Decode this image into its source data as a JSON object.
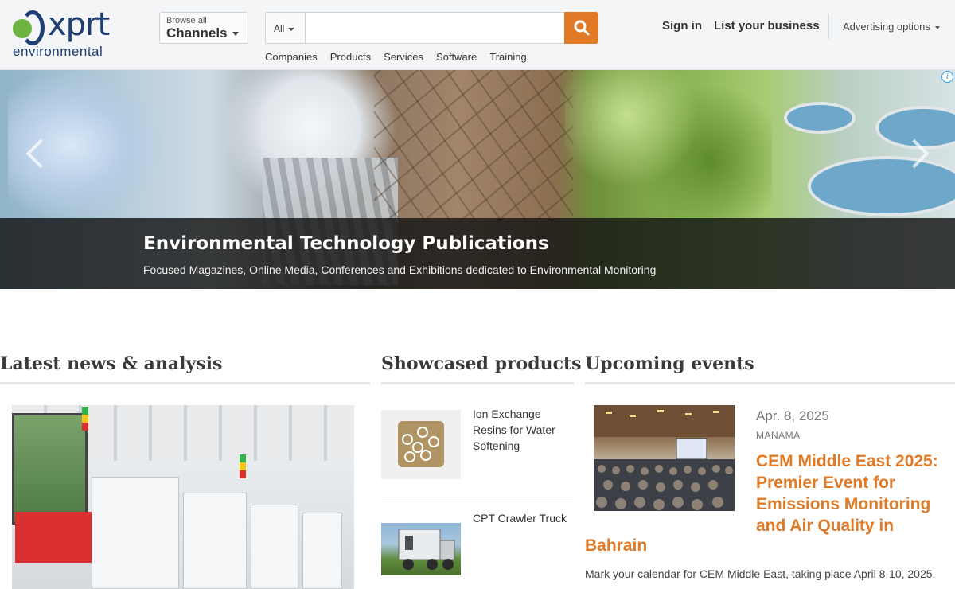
{
  "header": {
    "logo_word": "xprt",
    "logo_sub": "environmental",
    "browse_small": "Browse all",
    "browse_big": "Channels",
    "search": {
      "category": "All",
      "placeholder": ""
    },
    "categories": [
      "Companies",
      "Products",
      "Services",
      "Software",
      "Training"
    ],
    "sign_in": "Sign in",
    "list_business": "List your business",
    "advertising": "Advertising options"
  },
  "hero": {
    "title": "Environmental Technology Publications",
    "subtitle": "Focused Magazines, Online Media, Conferences and Exhibitions dedicated to Environmental Monitoring",
    "ad_info": "i"
  },
  "sections": {
    "news": {
      "title": "Latest news & analysis"
    },
    "products": {
      "title": "Showcased products",
      "items": [
        {
          "name": "Ion Exchange Resins for Water Softening"
        },
        {
          "name": "CPT Crawler Truck"
        }
      ]
    },
    "events": {
      "title": "Upcoming events",
      "date": "Apr. 8, 2025",
      "city": "MANAMA",
      "event_title_part1": "CEM Middle East 2025: Premier Event for Emissions Monitoring and Air Quality in",
      "event_title_part2": "Bahrain",
      "description": "Mark your calendar for CEM Middle East, taking place April 8-10, 2025,"
    }
  },
  "colors": {
    "accent": "#e07a26",
    "brand_blue": "#1f3e73",
    "brand_green": "#6cb33f"
  }
}
